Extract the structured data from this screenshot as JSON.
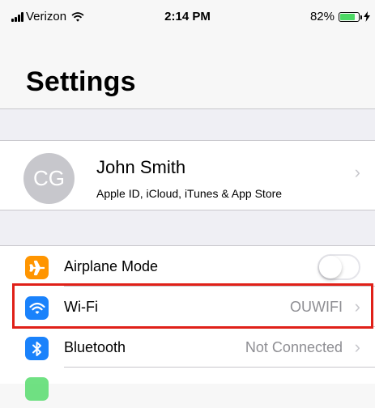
{
  "status_bar": {
    "carrier": "Verizon",
    "time": "2:14 PM",
    "battery_percent": "82%",
    "battery_level": 0.82,
    "icons": [
      "signal-bars-icon",
      "wifi-icon",
      "battery-icon",
      "charging-bolt-icon"
    ]
  },
  "page": {
    "title": "Settings"
  },
  "profile": {
    "initials": "CG",
    "name": "John Smith",
    "subtitle": "Apple ID, iCloud, iTunes & App Store"
  },
  "settings": {
    "airplane": {
      "label": "Airplane Mode",
      "enabled": false,
      "icon": "airplane-icon",
      "icon_color": "#ff9500"
    },
    "wifi": {
      "label": "Wi-Fi",
      "value": "OUWIFI",
      "icon": "wifi-icon",
      "icon_color": "#1a82fb",
      "highlighted": true
    },
    "bluetooth": {
      "label": "Bluetooth",
      "value": "Not Connected",
      "icon": "bluetooth-icon",
      "icon_color": "#1a82fb"
    },
    "next_row_icon_color": "#4cd964"
  },
  "colors": {
    "highlight_border": "#e02018",
    "chevron": "#c7c7cc",
    "secondary_text": "#8e8e93"
  }
}
